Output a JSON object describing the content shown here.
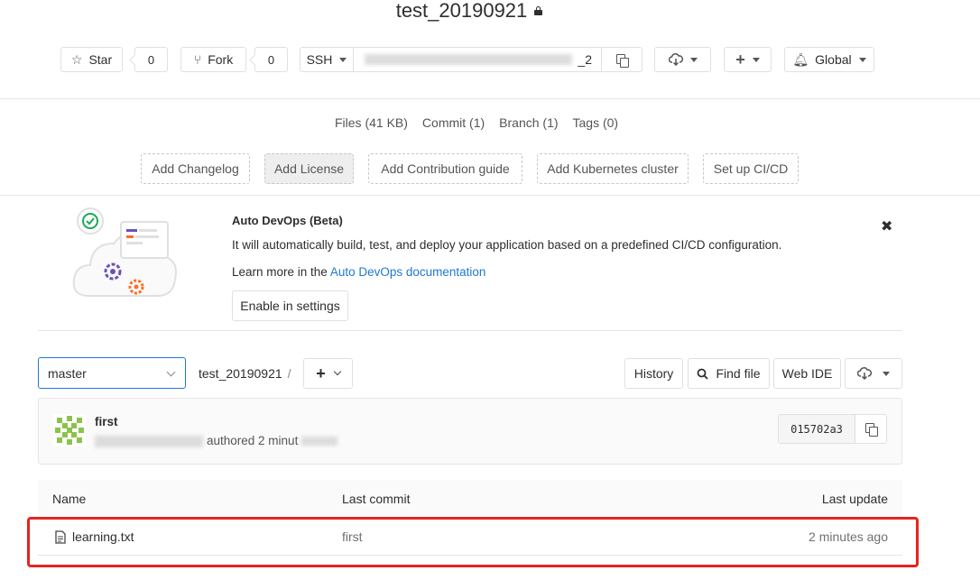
{
  "project": {
    "title": "test_20190921"
  },
  "actions": {
    "star_label": "Star",
    "star_count": "0",
    "fork_label": "Fork",
    "fork_count": "0",
    "clone_protocol": "SSH",
    "clone_url_visible": "_2",
    "notification_label": "Global"
  },
  "stats": {
    "files": "Files (41 KB)",
    "commits": "Commit (1)",
    "branches": "Branch (1)",
    "tags": "Tags (0)"
  },
  "quick_actions": [
    "Add Changelog",
    "Add License",
    "Add Contribution guide",
    "Add Kubernetes cluster",
    "Set up CI/CD"
  ],
  "devops": {
    "title": "Auto DevOps (Beta)",
    "description": "It will automatically build, test, and deploy your application based on a predefined CI/CD configuration.",
    "learn_prefix": "Learn more in the",
    "learn_link": "Auto DevOps documentation",
    "enable_button": "Enable in settings"
  },
  "repo": {
    "branch": "master",
    "path": "test_20190921",
    "path_separator": "/",
    "history": "History",
    "find_file": "Find file",
    "web_ide": "Web IDE"
  },
  "last_commit": {
    "title": "first",
    "meta_visible": "authored 2 minut",
    "sha": "015702a3"
  },
  "file_table": {
    "headers": {
      "name": "Name",
      "last_commit": "Last commit",
      "last_update": "Last update"
    },
    "rows": [
      {
        "name": "learning.txt",
        "commit": "first",
        "updated": "2 minutes ago"
      }
    ]
  },
  "colors": {
    "link": "#1f78d1",
    "highlight": "#e8231e",
    "avatar": "#8bc34a"
  }
}
